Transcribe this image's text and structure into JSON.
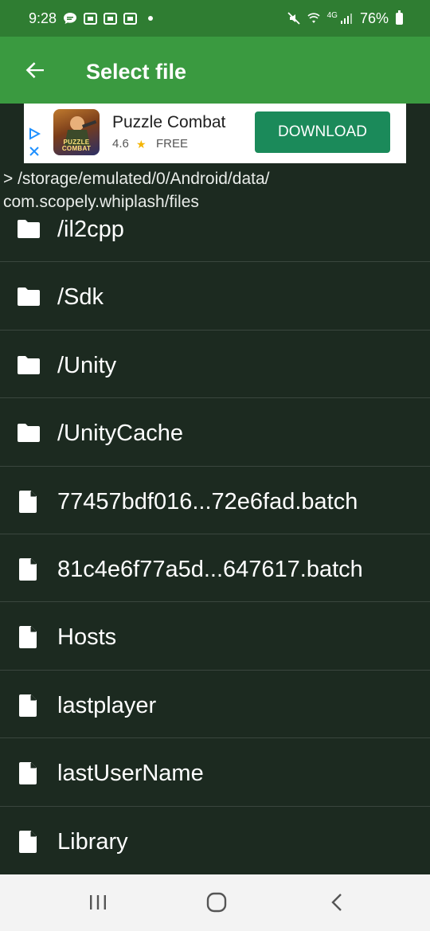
{
  "status_bar": {
    "time": "9:28",
    "network": "4G",
    "battery": "76%"
  },
  "app_bar": {
    "title": "Select file"
  },
  "ad": {
    "app_name": "Puzzle Combat",
    "rating": "4.6",
    "price": "FREE",
    "button": "DOWNLOAD",
    "logo_text": "PUZZLE COMBAT"
  },
  "path": "> /storage/emulated/0/Android/data/ com.scopely.whiplash/files",
  "files": [
    {
      "name": "/il2cpp",
      "type": "folder"
    },
    {
      "name": "/Sdk",
      "type": "folder"
    },
    {
      "name": "/Unity",
      "type": "folder"
    },
    {
      "name": "/UnityCache",
      "type": "folder"
    },
    {
      "name": "77457bdf016...72e6fad.batch",
      "type": "file"
    },
    {
      "name": "81c4e6f77a5d...647617.batch",
      "type": "file"
    },
    {
      "name": "Hosts",
      "type": "file"
    },
    {
      "name": "lastplayer",
      "type": "file"
    },
    {
      "name": "lastUserName",
      "type": "file"
    },
    {
      "name": "Library",
      "type": "file"
    }
  ],
  "colors": {
    "status_bar": "#2f7d32",
    "app_bar": "#3a9a40",
    "background": "#1c2a20",
    "download": "#1b8a5a"
  },
  "icons": {
    "folder": "folder-icon",
    "file": "file-icon",
    "back": "arrow-back-icon"
  }
}
